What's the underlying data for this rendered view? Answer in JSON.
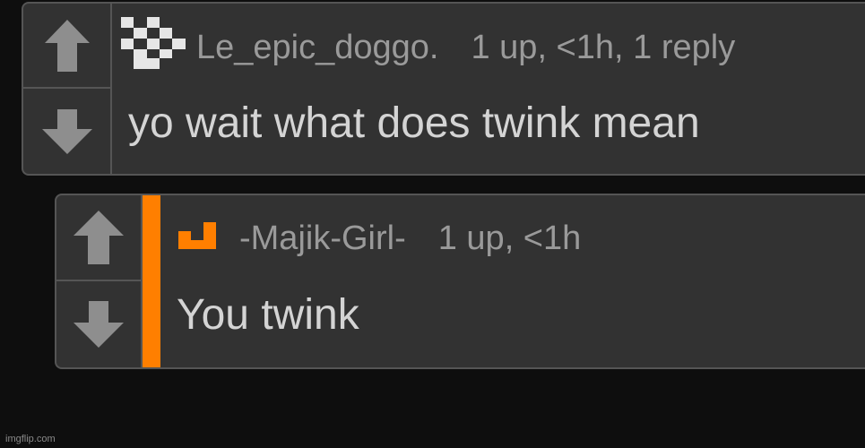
{
  "comments": [
    {
      "username": "Le_epic_doggo.",
      "meta": "1 up, <1h, 1 reply",
      "text": "yo wait what does twink mean",
      "avatar_color": "#e6e6e6"
    },
    {
      "username": "-Majik-Girl-",
      "meta": "1 up, <1h",
      "text": "You twink",
      "avatar_color": "#ff7f00",
      "reply_bar_color": "#ff7f00"
    }
  ],
  "icons": {
    "upvote": "arrow-up-icon",
    "downvote": "arrow-down-icon"
  },
  "watermark": "imgflip.com"
}
